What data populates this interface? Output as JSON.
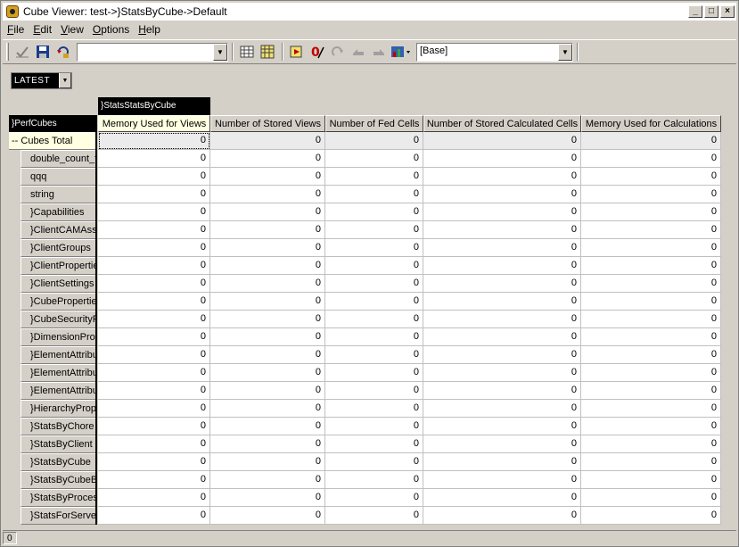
{
  "window": {
    "title": "Cube Viewer: test->}StatsByCube->Default",
    "min_label": "_",
    "max_label": "□",
    "close_label": "×"
  },
  "menu": [
    {
      "pre": "",
      "mn": "F",
      "post": "ile"
    },
    {
      "pre": "",
      "mn": "E",
      "post": "dit"
    },
    {
      "pre": "",
      "mn": "V",
      "post": "iew"
    },
    {
      "pre": "",
      "mn": "O",
      "post": "ptions"
    },
    {
      "pre": "",
      "mn": "H",
      "post": "elp"
    }
  ],
  "toolbar": {
    "view_combo_value": "",
    "subset_combo_value": "[Base]",
    "icons": [
      "recalc-check-icon",
      "save-icon",
      "refresh-icon",
      "grid-icon",
      "calculator-icon",
      "export-icon",
      "zero-suppress-icon",
      "redo-icon",
      "undo-icon",
      "forward-icon",
      "chart-icon"
    ]
  },
  "title_dimension": {
    "selected": "LATEST"
  },
  "dimensions": {
    "column_dim": "}StatsStatsByCube",
    "row_dim": "}PerfCubes"
  },
  "columns": [
    "Memory Used for Views",
    "Number of Stored Views",
    "Number of Fed Cells",
    "Number of Stored Calculated Cells",
    "Memory Used for Calculations"
  ],
  "rows": [
    {
      "label": "-- Cubes Total",
      "values": [
        "0",
        "0",
        "0",
        "0",
        "0"
      ]
    },
    {
      "label": "double_count_t",
      "values": [
        "0",
        "0",
        "0",
        "0",
        "0"
      ]
    },
    {
      "label": "qqq",
      "values": [
        "0",
        "0",
        "0",
        "0",
        "0"
      ]
    },
    {
      "label": "string",
      "values": [
        "0",
        "0",
        "0",
        "0",
        "0"
      ]
    },
    {
      "label": "}Capabilities",
      "values": [
        "0",
        "0",
        "0",
        "0",
        "0"
      ]
    },
    {
      "label": "}ClientCAMAsso",
      "values": [
        "0",
        "0",
        "0",
        "0",
        "0"
      ]
    },
    {
      "label": "}ClientGroups",
      "values": [
        "0",
        "0",
        "0",
        "0",
        "0"
      ]
    },
    {
      "label": "}ClientPropertie",
      "values": [
        "0",
        "0",
        "0",
        "0",
        "0"
      ]
    },
    {
      "label": "}ClientSettings",
      "values": [
        "0",
        "0",
        "0",
        "0",
        "0"
      ]
    },
    {
      "label": "}CubePropertie",
      "values": [
        "0",
        "0",
        "0",
        "0",
        "0"
      ]
    },
    {
      "label": "}CubeSecurityP",
      "values": [
        "0",
        "0",
        "0",
        "0",
        "0"
      ]
    },
    {
      "label": "}DimensionProp",
      "values": [
        "0",
        "0",
        "0",
        "0",
        "0"
      ]
    },
    {
      "label": "}ElementAttribu",
      "values": [
        "0",
        "0",
        "0",
        "0",
        "0"
      ]
    },
    {
      "label": "}ElementAttribu",
      "values": [
        "0",
        "0",
        "0",
        "0",
        "0"
      ]
    },
    {
      "label": "}ElementAttribu",
      "values": [
        "0",
        "0",
        "0",
        "0",
        "0"
      ]
    },
    {
      "label": "}HierarchyProp",
      "values": [
        "0",
        "0",
        "0",
        "0",
        "0"
      ]
    },
    {
      "label": "}StatsByChore",
      "values": [
        "0",
        "0",
        "0",
        "0",
        "0"
      ]
    },
    {
      "label": "}StatsByClient",
      "values": [
        "0",
        "0",
        "0",
        "0",
        "0"
      ]
    },
    {
      "label": "}StatsByCube",
      "values": [
        "0",
        "0",
        "0",
        "0",
        "0"
      ]
    },
    {
      "label": "}StatsByCubeB",
      "values": [
        "0",
        "0",
        "0",
        "0",
        "0"
      ]
    },
    {
      "label": "}StatsByProces",
      "values": [
        "0",
        "0",
        "0",
        "0",
        "0"
      ]
    },
    {
      "label": "}StatsForServe",
      "values": [
        "0",
        "0",
        "0",
        "0",
        "0"
      ]
    }
  ],
  "status": {
    "value": "0"
  },
  "colors": {
    "header_bg": "#d4d0c8",
    "selected_header_bg": "#ffffe1",
    "dim_label_bg": "#000000"
  }
}
